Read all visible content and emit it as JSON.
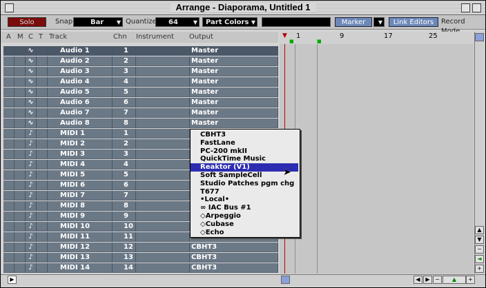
{
  "window": {
    "title": "Arrange - Diaporama, Untitled 1"
  },
  "toolbar": {
    "solo": "Solo",
    "snap_label": "Snap",
    "snap_value": "Bar",
    "quantize_label": "Quantize",
    "quantize_value": "64",
    "part_colors": "Part Colors",
    "marker": "Marker",
    "link_editors": "Link Editors",
    "record_mode": "Record Mode"
  },
  "columns": {
    "a": "A",
    "m": "M",
    "c": "C",
    "t": "T",
    "track": "Track",
    "chn": "Chn",
    "instrument": "Instrument",
    "output": "Output"
  },
  "ruler": [
    "1",
    "9",
    "17",
    "25"
  ],
  "tracks": [
    {
      "icon": "∿",
      "name": "Audio  1",
      "chn": "1",
      "out": "Master",
      "sel": true
    },
    {
      "icon": "∿",
      "name": "Audio  2",
      "chn": "2",
      "out": "Master"
    },
    {
      "icon": "∿",
      "name": "Audio  3",
      "chn": "3",
      "out": "Master"
    },
    {
      "icon": "∿",
      "name": "Audio  4",
      "chn": "4",
      "out": "Master"
    },
    {
      "icon": "∿",
      "name": "Audio  5",
      "chn": "5",
      "out": "Master"
    },
    {
      "icon": "∿",
      "name": "Audio  6",
      "chn": "6",
      "out": "Master"
    },
    {
      "icon": "∿",
      "name": "Audio  7",
      "chn": "7",
      "out": "Master"
    },
    {
      "icon": "∿",
      "name": "Audio  8",
      "chn": "8",
      "out": "Master"
    },
    {
      "icon": "♪",
      "name": "MIDI  1",
      "chn": "1",
      "out": ""
    },
    {
      "icon": "♪",
      "name": "MIDI  2",
      "chn": "2",
      "out": ""
    },
    {
      "icon": "♪",
      "name": "MIDI  3",
      "chn": "3",
      "out": ""
    },
    {
      "icon": "♪",
      "name": "MIDI  4",
      "chn": "4",
      "out": ""
    },
    {
      "icon": "♪",
      "name": "MIDI  5",
      "chn": "5",
      "out": ""
    },
    {
      "icon": "♪",
      "name": "MIDI  6",
      "chn": "6",
      "out": ""
    },
    {
      "icon": "♪",
      "name": "MIDI  7",
      "chn": "7",
      "out": ""
    },
    {
      "icon": "♪",
      "name": "MIDI  8",
      "chn": "8",
      "out": ""
    },
    {
      "icon": "♪",
      "name": "MIDI  9",
      "chn": "9",
      "out": ""
    },
    {
      "icon": "♪",
      "name": "MIDI  10",
      "chn": "10",
      "out": ""
    },
    {
      "icon": "♪",
      "name": "MIDI  11",
      "chn": "11",
      "out": "CBHT3"
    },
    {
      "icon": "♪",
      "name": "MIDI  12",
      "chn": "12",
      "out": "CBHT3"
    },
    {
      "icon": "♪",
      "name": "MIDI  13",
      "chn": "13",
      "out": "CBHT3"
    },
    {
      "icon": "♪",
      "name": "MIDI  14",
      "chn": "14",
      "out": "CBHT3"
    }
  ],
  "output_menu": {
    "items": [
      "CBHT3",
      "FastLane",
      "PC-200 mkII",
      "QuickTime Music",
      "Reaktor (V1)",
      "Soft SampleCell",
      "Studio Patches pgm chg",
      "T677",
      "•Local•",
      "∞ IAC Bus #1",
      "◇Arpeggio",
      "◇Cubase",
      "◇Echo"
    ],
    "highlighted_index": 4
  },
  "colors": {
    "accent": "#2c2cb2",
    "solo": "#7a0c0c",
    "track_row": "#6b7886"
  }
}
